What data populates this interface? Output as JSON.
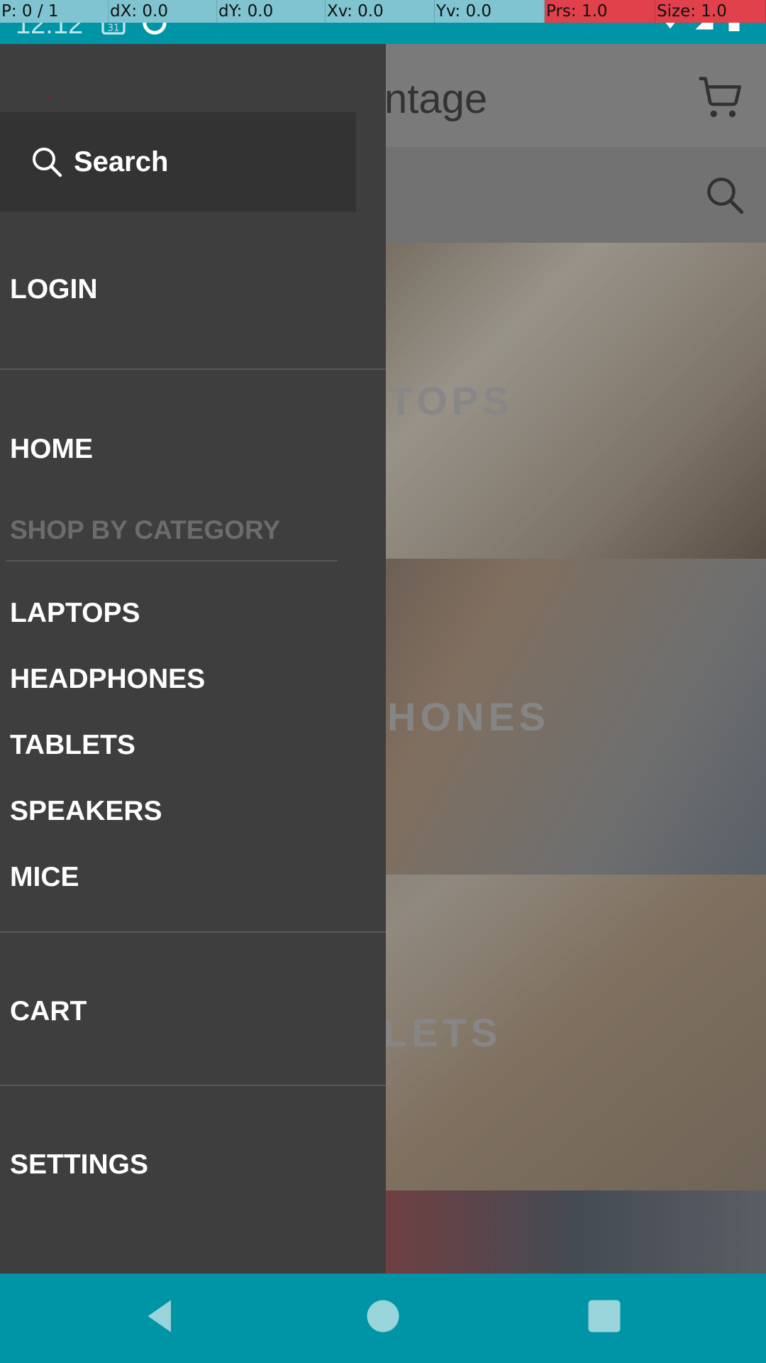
{
  "debug_overlay": {
    "pointer": "P: 0 / 1",
    "dx": "dX: 0.0",
    "dy": "dY: 0.0",
    "xv": "Xv: 0.0",
    "yv": "Yv: 0.0",
    "prs": "Prs: 1.0",
    "size": "Size: 1.0"
  },
  "status_bar": {
    "time": "12:12",
    "calendar_day": "31",
    "icons": [
      "calendar-icon",
      "notification-icon",
      "wifi-icon",
      "signal-icon",
      "battery-icon"
    ]
  },
  "main_page": {
    "title_partial": "ntage",
    "header_icons": [
      "cart-icon",
      "search-icon"
    ],
    "tiles": [
      {
        "label": "TOPS"
      },
      {
        "label": "HONES"
      },
      {
        "label": "LETS"
      }
    ]
  },
  "drawer": {
    "search_label": "Search",
    "login": "LOGIN",
    "home": "HOME",
    "category_heading": "SHOP BY CATEGORY",
    "categories": [
      "LAPTOPS",
      "HEADPHONES",
      "TABLETS",
      "SPEAKERS",
      "MICE"
    ],
    "cart": "CART",
    "settings": "SETTINGS"
  },
  "nav_bar": {
    "buttons": [
      "back-icon",
      "home-icon",
      "recents-icon"
    ]
  },
  "colors": {
    "accent": "#0095a6",
    "drawer_bg": "#3e3e3e",
    "drawer_search_bg": "#333333",
    "heading_text": "#6c6c6c",
    "debug_bar": "#7fc4d0",
    "debug_bar_alert": "#e0414b"
  }
}
